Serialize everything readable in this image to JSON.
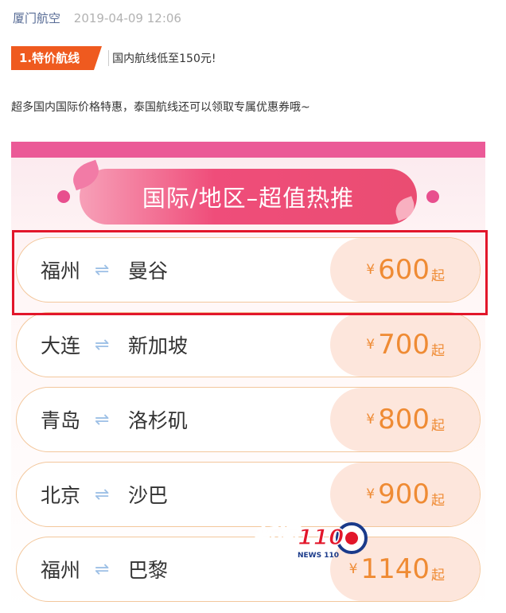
{
  "article": {
    "account": "厦门航空",
    "datetime": "2019-04-09 12:06",
    "tag": "1.特价航线",
    "tag_desc": "国内航线低至150元!",
    "intro": "超多国内国际价格特惠，泰国航线还可以领取专属优惠券哦~"
  },
  "promo": {
    "banner_title": "国际/地区–超值热推",
    "currency": "¥",
    "price_suffix": "起",
    "arrow_glyph": "⇌",
    "routes": [
      {
        "from": "福州",
        "to": "曼谷",
        "price": "600"
      },
      {
        "from": "大连",
        "to": "新加坡",
        "price": "700"
      },
      {
        "from": "青岛",
        "to": "洛杉矶",
        "price": "800"
      },
      {
        "from": "北京",
        "to": "沙巴",
        "price": "900"
      },
      {
        "from": "福州",
        "to": "巴黎",
        "price": "1140"
      }
    ]
  },
  "watermark": {
    "text": "新闻110",
    "sub": "NEWS 110"
  },
  "colors": {
    "tag": "#ef5a1f",
    "banner": "#ea4d72",
    "price": "#ef8b34",
    "highlight": "#e2162a",
    "link": "#576b95"
  }
}
